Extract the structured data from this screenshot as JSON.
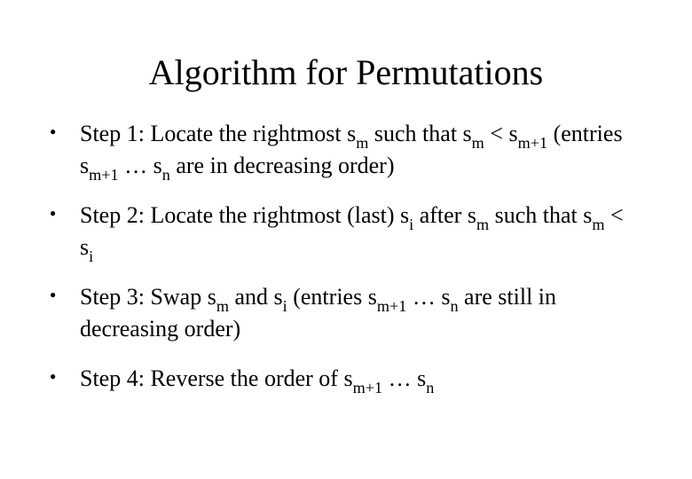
{
  "title": "Algorithm for Permutations",
  "steps": [
    {
      "lead": "Step 1: Locate the rightmost s",
      "sub1": "m",
      "mid1": " such that s",
      "sub2": "m",
      "mid2": " < s",
      "sub3": "m+1",
      "mid3": " (entries s",
      "sub4": "m+1",
      "mid4": " … s",
      "sub5": "n",
      "tail": " are in decreasing order)"
    },
    {
      "lead": "Step 2: Locate the rightmost (last) s",
      "sub1": "i",
      "mid1": " after s",
      "sub2": "m",
      "mid2": " such that s",
      "sub3": "m",
      "mid3": " < s",
      "sub4": "i",
      "mid4": "",
      "sub5": "",
      "tail": ""
    },
    {
      "lead": "Step 3: Swap s",
      "sub1": "m",
      "mid1": " and s",
      "sub2": "i",
      "mid2": "  (entries s",
      "sub3": "m+1",
      "mid3": " … s",
      "sub4": "n",
      "mid4": " are still in decreasing order)",
      "sub5": "",
      "tail": ""
    },
    {
      "lead": "Step 4: Reverse the order of s",
      "sub1": "m+1",
      "mid1": " … s",
      "sub2": "n",
      "mid2": "",
      "sub3": "",
      "mid3": "",
      "sub4": "",
      "mid4": "",
      "sub5": "",
      "tail": ""
    }
  ]
}
